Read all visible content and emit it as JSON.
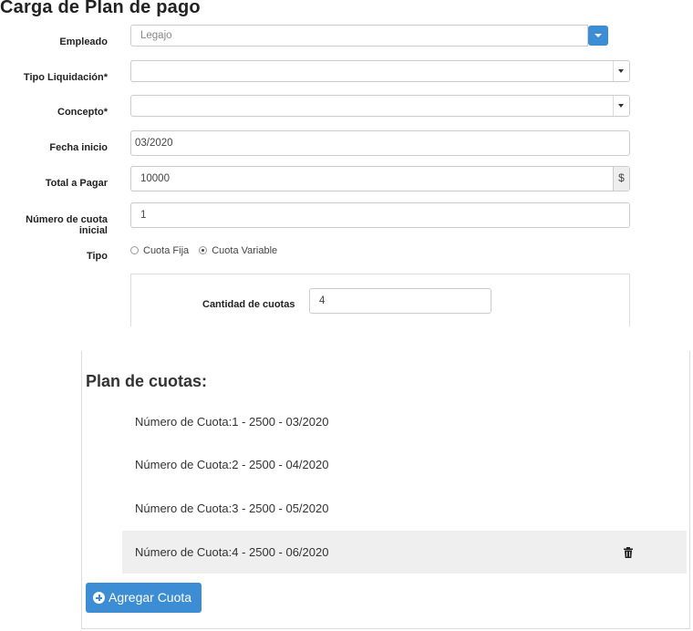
{
  "page": {
    "title": "Carga de Plan de pago"
  },
  "form": {
    "empleado": {
      "label": "Empleado",
      "placeholder": "Legajo"
    },
    "tipo_liquidacion": {
      "label": "Tipo Liquidación*",
      "value": ""
    },
    "concepto": {
      "label": "Concepto*",
      "value": ""
    },
    "fecha_inicio": {
      "label": "Fecha inicio",
      "value": "03/2020"
    },
    "total_a_pagar": {
      "label": "Total a Pagar",
      "value": "10000",
      "addon": "$"
    },
    "numero_cuota_inicial": {
      "label": "Número de cuota inicial",
      "value": "1"
    },
    "tipo": {
      "label": "Tipo",
      "options": [
        "Cuota Fija",
        "Cuota Variable"
      ],
      "selected": "Cuota Variable"
    },
    "cantidad_cuotas": {
      "label": "Cantidad de cuotas",
      "value": "4"
    }
  },
  "plan": {
    "title": "Plan de cuotas:",
    "items": [
      "Número de Cuota:1 - 2500 - 03/2020",
      "Número de Cuota:2 - 2500 - 04/2020",
      "Número de Cuota:3 - 2500 - 05/2020",
      "Número de Cuota:4 - 2500 - 06/2020"
    ],
    "add_button": "Agregar Cuota"
  },
  "colors": {
    "primary": "#3c8dd3",
    "row_hover": "#efefef",
    "border": "#cccccc"
  },
  "icons": {
    "dropdown": "caret-down-icon",
    "delete": "trash-icon",
    "add": "plus-circle-icon"
  }
}
